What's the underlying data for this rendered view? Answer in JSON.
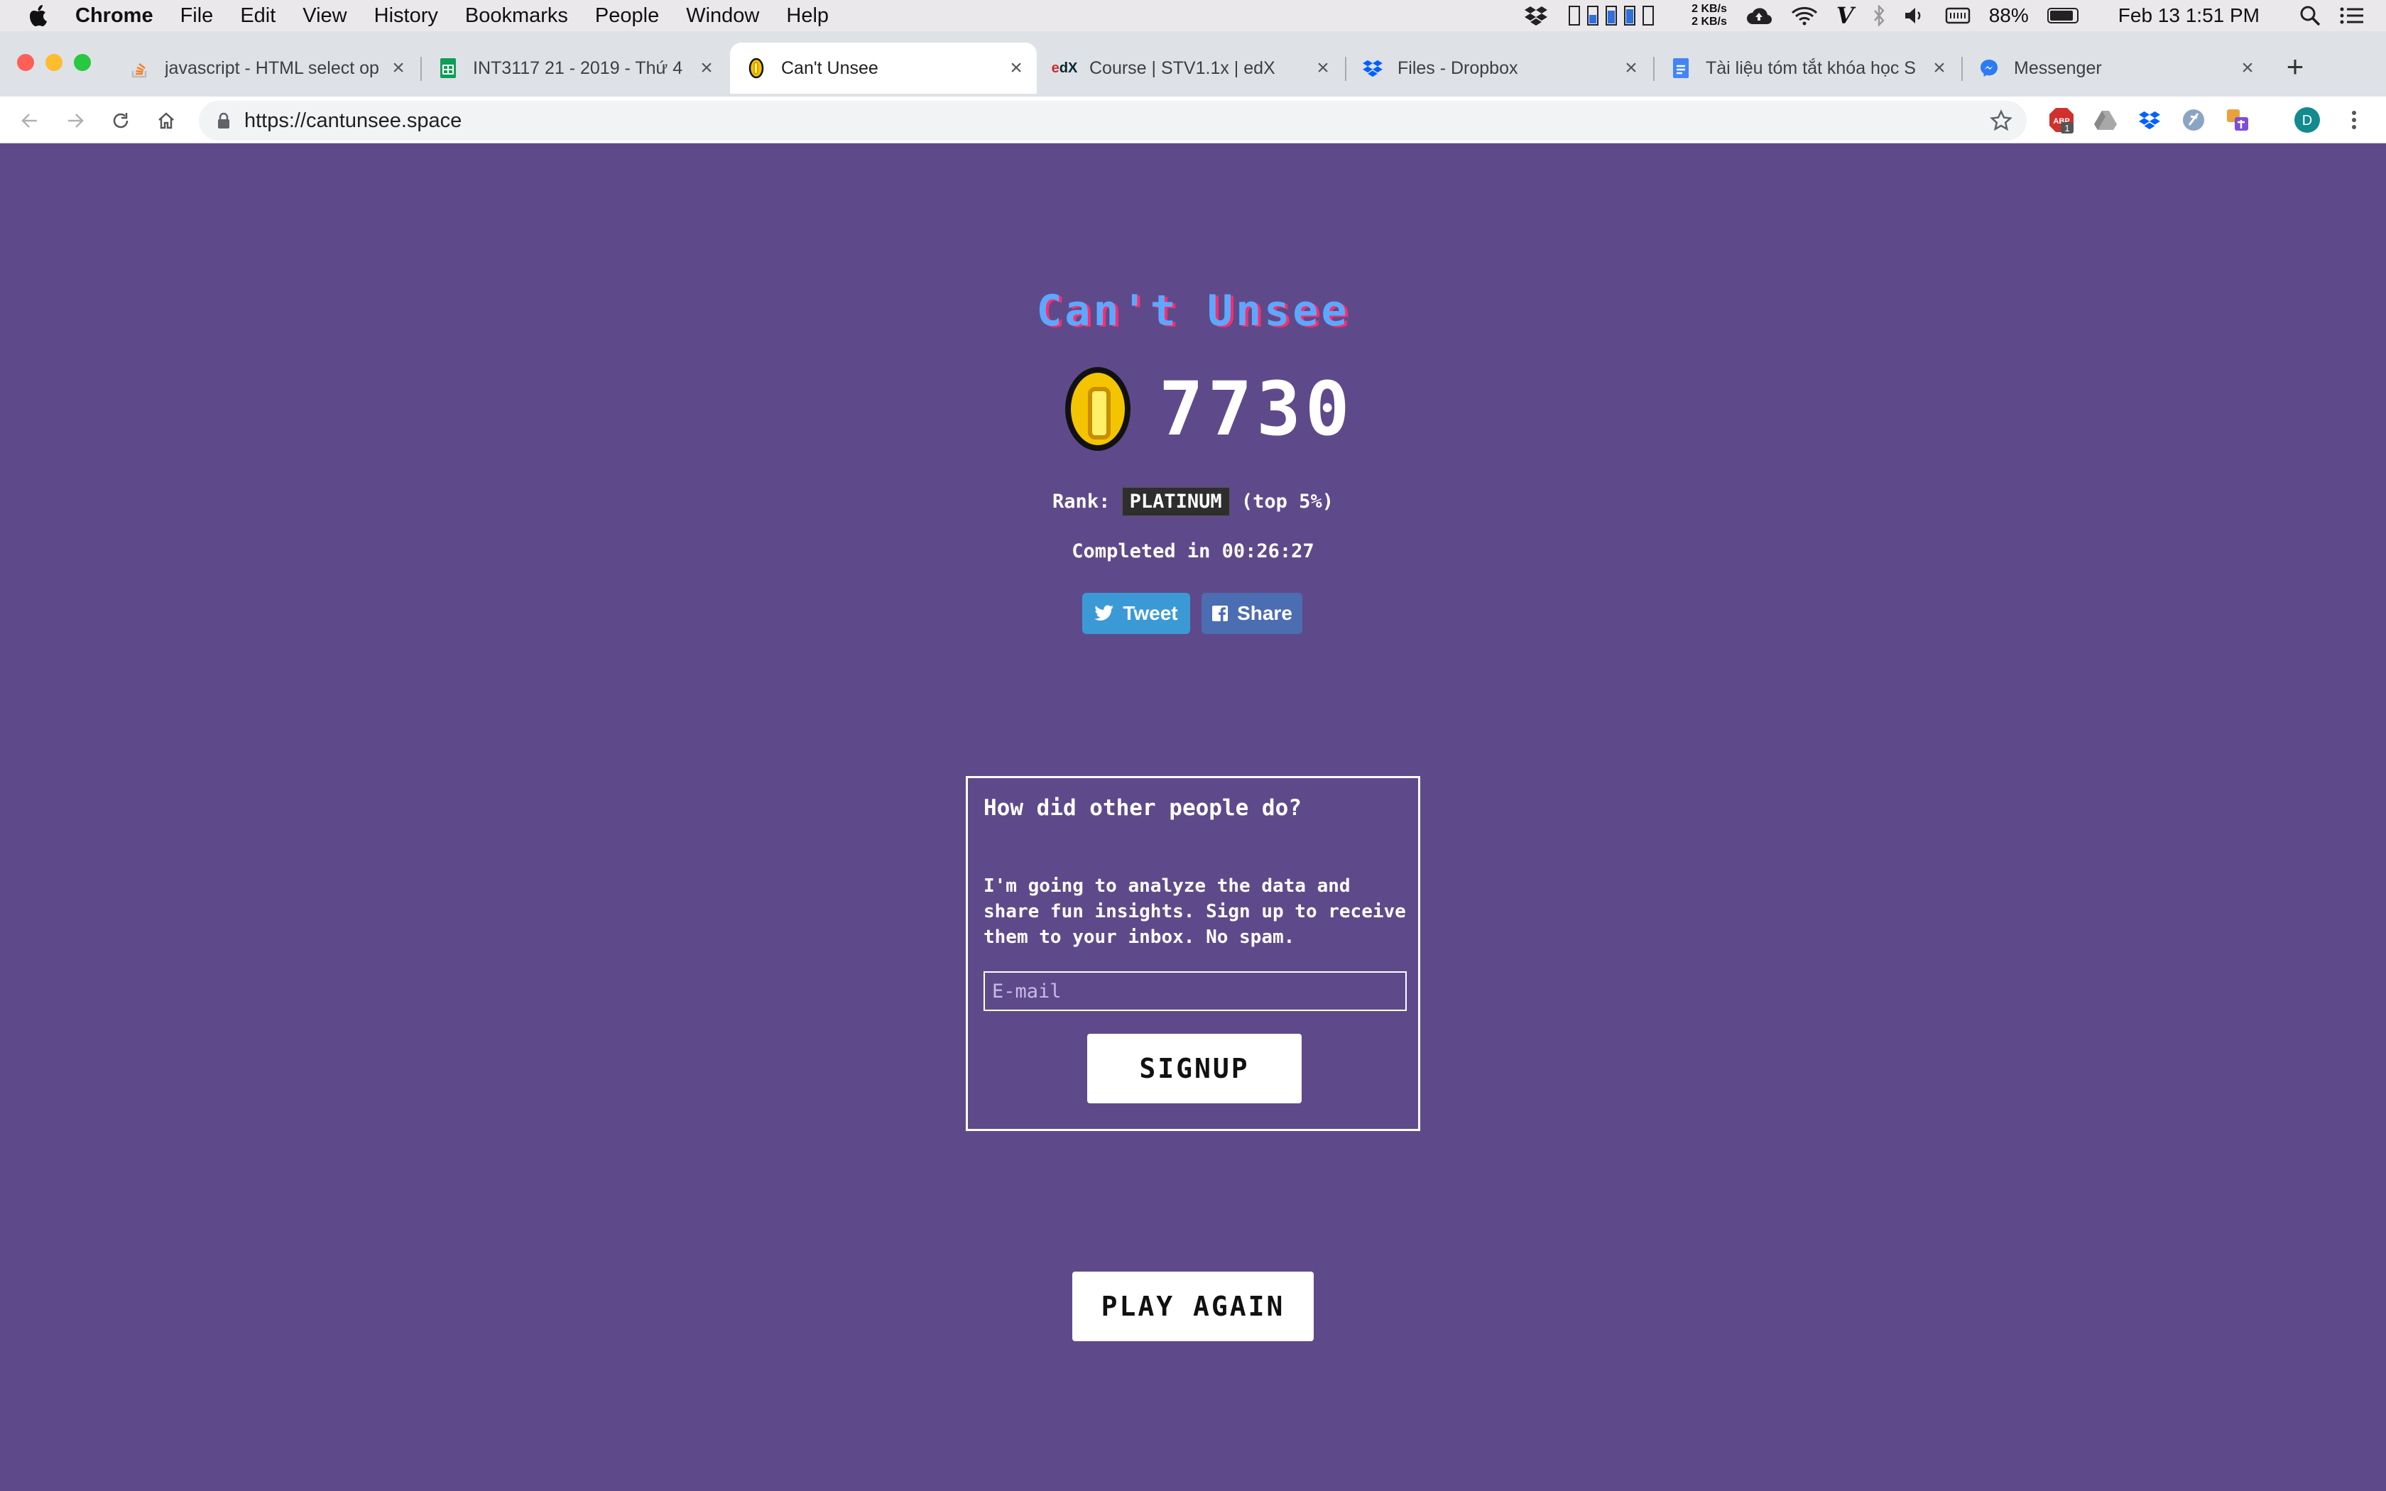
{
  "menubar": {
    "app": "Chrome",
    "items": [
      "File",
      "Edit",
      "View",
      "History",
      "Bookmarks",
      "People",
      "Window",
      "Help"
    ],
    "net_up": "2 KB/s",
    "net_down": "2 KB/s",
    "battery": "88%",
    "datetime": "Feb 13  1:51 PM"
  },
  "tabs": [
    {
      "title": "javascript - HTML select op",
      "icon": "stackoverflow-icon"
    },
    {
      "title": "INT3117 21 - 2019 - Thứ 4",
      "icon": "sheets-icon"
    },
    {
      "title": "Can't Unsee",
      "icon": "coin-icon"
    },
    {
      "title": "Course | STV1.1x | edX",
      "icon": "edx-icon"
    },
    {
      "title": "Files - Dropbox",
      "icon": "dropbox-icon"
    },
    {
      "title": "Tài liệu tóm tắt khóa học S",
      "icon": "docs-icon"
    },
    {
      "title": "Messenger",
      "icon": "messenger-icon"
    }
  ],
  "toolbar": {
    "url": "https://cantunsee.space",
    "profile_initial": "D",
    "ext_badge": "1"
  },
  "game": {
    "title": "Can't Unsee",
    "score": "7730",
    "rank_label": "Rank:",
    "rank": "PLATINUM",
    "rank_note": "(top 5%)",
    "completed_label": "Completed in",
    "completed_time": "00:26:27",
    "tweet_label": "Tweet",
    "share_label": "Share"
  },
  "signup": {
    "heading": "How did other people do?",
    "text": "I'm going to analyze the data and share fun insights. Sign up to receive them to your inbox. No spam.",
    "email_placeholder": "E-mail",
    "button": "SIGNUP"
  },
  "play_again": "PLAY AGAIN",
  "colors": {
    "page_bg": "#5e4a8a",
    "title_blue": "#5da8ff",
    "title_shadow": "#ff2d6e",
    "tweet": "#3b9ad6",
    "share": "#4b6db2"
  }
}
